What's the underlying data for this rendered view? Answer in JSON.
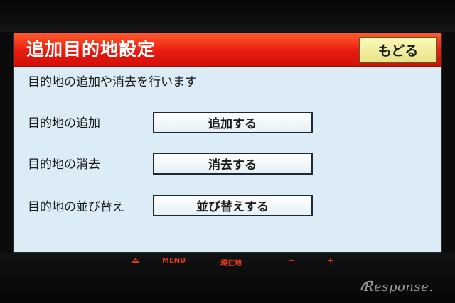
{
  "header": {
    "title": "追加目的地設定",
    "back_label": "もどる"
  },
  "description": "目的地の追加や消去を行います",
  "rows": [
    {
      "label": "目的地の追加",
      "button": "追加する"
    },
    {
      "label": "目的地の消去",
      "button": "消去する"
    },
    {
      "label": "目的地の並び替え",
      "button": "並び替えする"
    }
  ],
  "controls": {
    "eject": "⏏",
    "menu": "MENU",
    "current_location": "現在地",
    "minus": "−",
    "plus": "+"
  },
  "watermark": "Response.",
  "colors": {
    "titlebar": "#e81b10",
    "screen_bg": "#dcecf6",
    "back_button": "#f2f0a0",
    "control_text": "#e23a1c"
  }
}
